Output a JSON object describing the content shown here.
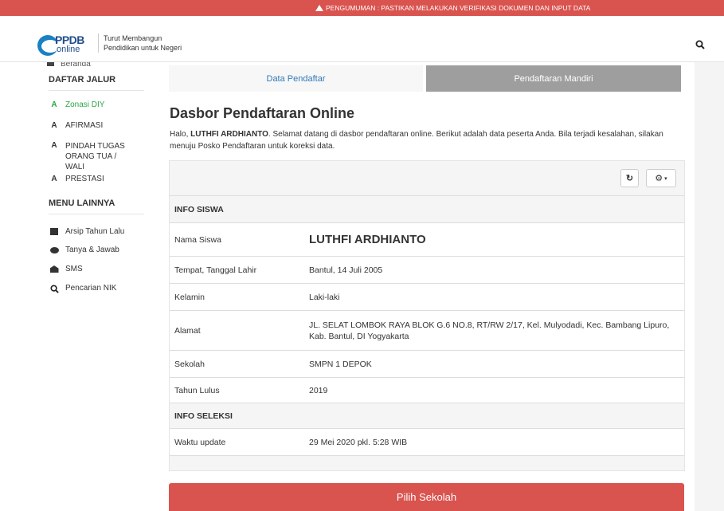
{
  "announcement": {
    "text": "PENGUMUMAN : PASTIKAN MELAKUKAN VERIFIKASI DOKUMEN DAN INPUT DATA"
  },
  "header": {
    "logo_ppdb": "PPDB",
    "logo_online": "online",
    "tagline_line1": "Turut Membangun",
    "tagline_line2": "Pendidikan untuk Negeri"
  },
  "sidebar": {
    "cut_item": "Beranda",
    "section1": "DAFTAR JALUR",
    "jalur": [
      {
        "label": "Zonasi DIY",
        "active": true,
        "icon": "road-icon"
      },
      {
        "label": "AFIRMASI",
        "active": false,
        "icon": "road-icon"
      },
      {
        "label": "PINDAH TUGAS ORANG TUA / WALI",
        "active": false,
        "icon": "road-icon"
      },
      {
        "label": "PRESTASI",
        "active": false,
        "icon": "road-icon"
      }
    ],
    "section2": "MENU LAINNYA",
    "menu": [
      {
        "label": "Arsip Tahun Lalu",
        "icon": "archive-icon"
      },
      {
        "label": "Tanya & Jawab",
        "icon": "comment-icon"
      },
      {
        "label": "SMS",
        "icon": "envelope-open-icon"
      },
      {
        "label": "Pencarian NIK",
        "icon": "search-icon"
      }
    ]
  },
  "tabs": {
    "tab1": "Data Pendaftar",
    "tab2": "Pendaftaran Mandiri"
  },
  "main": {
    "title": "Dasbor Pendaftaran Online",
    "intro_prefix": "Halo, ",
    "intro_name": "LUTHFI ARDHIANTO",
    "intro_rest": ". Selamat datang di dasbor pendaftaran online. Berikut adalah data peserta Anda. Bila terjadi kesalahan, silakan menuju Posko Pendaftaran untuk koreksi data."
  },
  "toolbar": {
    "refresh_icon": "↻",
    "settings_icon": "⚙",
    "caret": "▾"
  },
  "info": {
    "section_siswa": "INFO SISWA",
    "nama_label": "Nama Siswa",
    "nama_value": "LUTHFI ARDHIANTO",
    "ttl_label": "Tempat, Tanggal Lahir",
    "ttl_value": "Bantul, 14 Juli 2005",
    "kelamin_label": "Kelamin",
    "kelamin_value": "Laki-laki",
    "alamat_label": "Alamat",
    "alamat_value": "JL. SELAT LOMBOK RAYA BLOK G.6 NO.8, RT/RW 2/17, Kel. Mulyodadi, Kec. Bambang Lipuro, Kab. Bantul, DI Yogyakarta",
    "sekolah_label": "Sekolah",
    "sekolah_value": "SMPN 1 DEPOK",
    "lulus_label": "Tahun Lulus",
    "lulus_value": "2019",
    "section_seleksi": "INFO SELEKSI",
    "update_label": "Waktu update",
    "update_value": "29 Mei 2020 pkl. 5:28 WIB"
  },
  "button": {
    "pilih": "Pilih Sekolah"
  },
  "colors": {
    "accent_red": "#d9534f",
    "active_green": "#28a745",
    "link_blue": "#337ab7"
  }
}
